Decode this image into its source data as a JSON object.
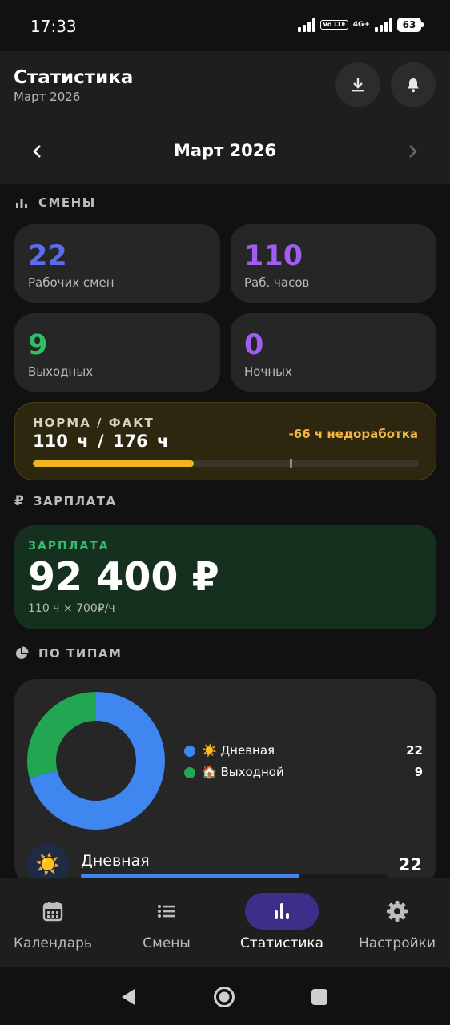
{
  "status_bar": {
    "time": "17:33",
    "network": "4G+",
    "volte": "Vo LTE",
    "battery": "63"
  },
  "header": {
    "title": "Статистика",
    "subtitle": "Март 2026"
  },
  "month_nav": {
    "label": "Март 2026"
  },
  "sections": {
    "shifts": "СМЕНЫ",
    "salary": "ЗАРПЛАТА",
    "types": "ПО ТИПАМ"
  },
  "stats": [
    {
      "value": "22",
      "label": "Рабочих смен",
      "color": "#5b6cf0"
    },
    {
      "value": "110",
      "label": "Раб. часов",
      "color": "#a05ef0"
    },
    {
      "value": "9",
      "label": "Выходных",
      "color": "#2fbf6a"
    },
    {
      "value": "0",
      "label": "Ночных",
      "color": "#a05ef0"
    }
  ],
  "norm": {
    "label": "НОРМА / ФАКТ",
    "value": "110 ч  /  176 ч",
    "deficit": "-66 ч недоработка",
    "progress": 0.4167,
    "marker": 0.665
  },
  "salary": {
    "label": "ЗАРПЛАТА",
    "amount": "92 400 ₽",
    "formula": "110 ч × 700₽/ч"
  },
  "types": {
    "legend": [
      {
        "name": "☀️ Дневная",
        "count": "22",
        "color": "#3f86f0"
      },
      {
        "name": "🏠 Выходной",
        "count": "9",
        "color": "#22a651"
      }
    ],
    "donut": [
      {
        "value": 22,
        "color": "#3f86f0"
      },
      {
        "value": 9,
        "color": "#22a651"
      }
    ],
    "item": {
      "icon": "☀️",
      "name": "Дневная",
      "count": "22",
      "progress": 0.71
    }
  },
  "bottom_nav": [
    {
      "label": "Календарь",
      "icon": "calendar-icon",
      "active": false
    },
    {
      "label": "Смены",
      "icon": "list-icon",
      "active": false
    },
    {
      "label": "Статистика",
      "icon": "bar-chart-icon",
      "active": true
    },
    {
      "label": "Настройки",
      "icon": "gear-icon",
      "active": false
    }
  ]
}
